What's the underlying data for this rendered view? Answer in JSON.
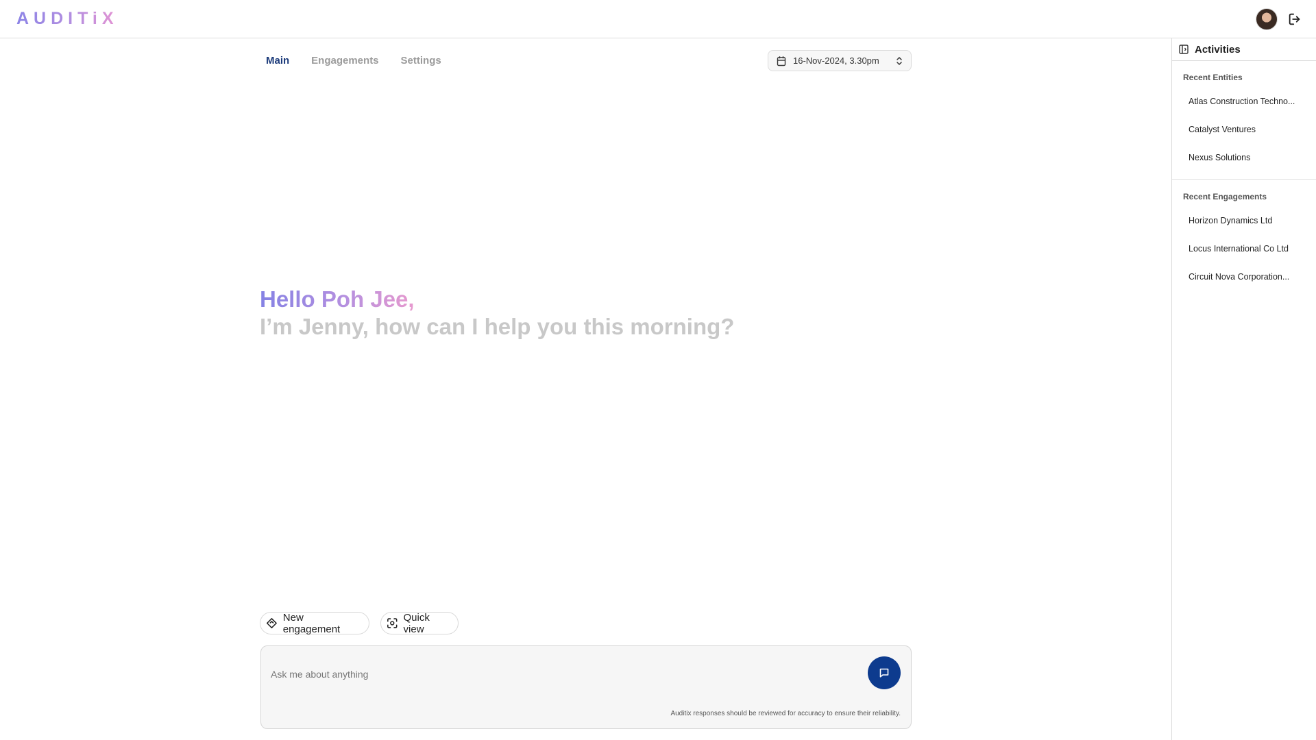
{
  "app": {
    "logo": "AUDITiX"
  },
  "header": {
    "avatar_alt": "user-avatar",
    "logout_icon": "logout-icon"
  },
  "tabs": [
    {
      "label": "Main",
      "active": true
    },
    {
      "label": "Engagements",
      "active": false
    },
    {
      "label": "Settings",
      "active": false
    }
  ],
  "datetime": {
    "value": "16-Nov-2024, 3.30pm",
    "icon": "calendar-icon",
    "chevron": "chevron-up-down-icon"
  },
  "greeting": {
    "hello": "Hello Poh Jee,",
    "subtitle": "I’m Jenny, how can I help you this morning?"
  },
  "actions": {
    "new_engagement": "New engagement",
    "quick_view": "Quick view"
  },
  "chat": {
    "placeholder": "Ask me about anything",
    "disclaimer": "Auditix responses should be reviewed for accuracy to ensure their reliability."
  },
  "activities": {
    "title": "Activities",
    "recent_entities_title": "Recent Entities",
    "recent_entities": [
      "Atlas Construction Techno...",
      "Catalyst Ventures",
      "Nexus Solutions"
    ],
    "recent_engagements_title": "Recent Engagements",
    "recent_engagements": [
      "Horizon Dynamics Ltd",
      "Locus International Co Ltd",
      "Circuit Nova Corporation..."
    ]
  },
  "colors": {
    "accent": "#0d3b8e",
    "active_tab": "#1b3a7a",
    "greeting_gradient": [
      "#8582e4",
      "#b38fe0",
      "#e599cf"
    ],
    "subtitle": "#c8c8c8"
  }
}
